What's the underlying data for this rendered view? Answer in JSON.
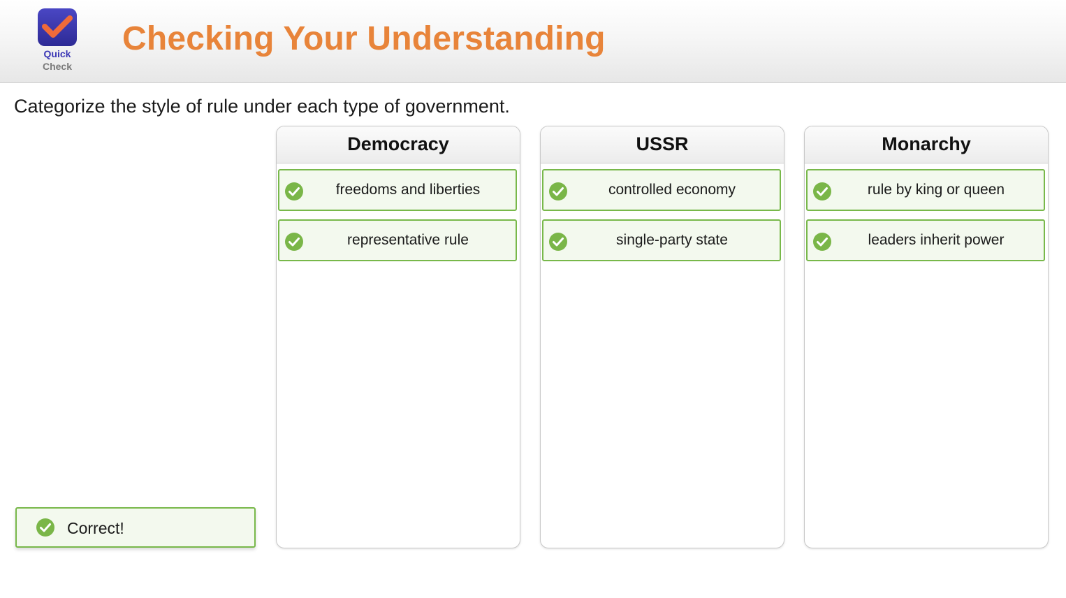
{
  "header": {
    "logo_line1": "Quick",
    "logo_line2": "Check",
    "title": "Checking Your Understanding"
  },
  "instructions": "Categorize the style of rule under each type of government.",
  "columns": [
    {
      "title": "Democracy",
      "items": [
        {
          "label": "freedoms and liberties",
          "status": "correct",
          "icon": "check-circle-icon"
        },
        {
          "label": "representative rule",
          "status": "correct",
          "icon": "check-circle-icon"
        }
      ]
    },
    {
      "title": "USSR",
      "items": [
        {
          "label": "controlled economy",
          "status": "correct",
          "icon": "check-circle-icon"
        },
        {
          "label": "single-party state",
          "status": "correct",
          "icon": "check-circle-icon"
        }
      ]
    },
    {
      "title": "Monarchy",
      "items": [
        {
          "label": "rule by king or queen",
          "status": "correct",
          "icon": "check-circle-icon"
        },
        {
          "label": "leaders inherit power",
          "status": "correct",
          "icon": "check-circle-icon"
        }
      ]
    }
  ],
  "feedback": {
    "label": "Correct!",
    "icon": "check-circle-icon"
  },
  "colors": {
    "title": "#e8843a",
    "correct_border": "#78b84a",
    "correct_fill": "#f3f9ee",
    "check_icon": "#7ab648",
    "logo": "#3a36b5"
  }
}
